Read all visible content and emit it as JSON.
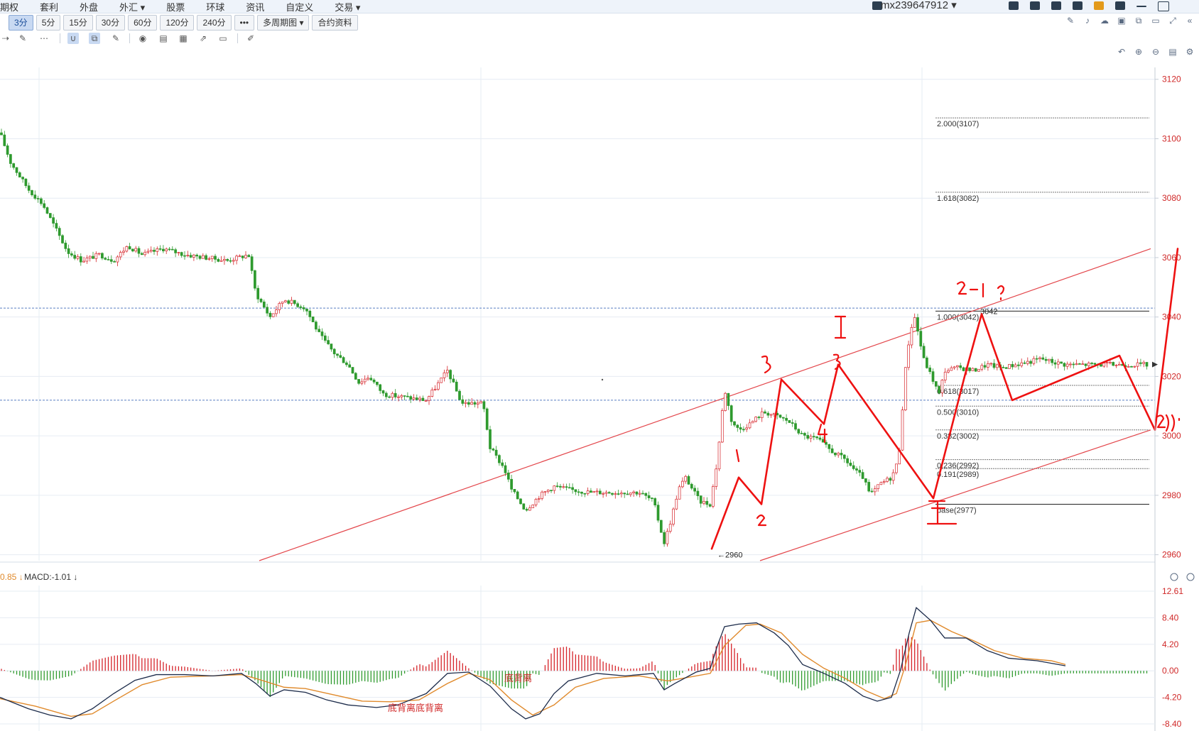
{
  "menu": {
    "items": [
      "期权",
      "套利",
      "外盘",
      "外汇 ▾",
      "股票",
      "环球",
      "资讯",
      "自定义",
      "交易 ▾"
    ],
    "username": "mx239647912",
    "username_suffix": "▾"
  },
  "timeframes": {
    "items": [
      "3分",
      "5分",
      "15分",
      "30分",
      "60分",
      "120分",
      "240分",
      "•••",
      "多周期图 ▾",
      "合约资料"
    ],
    "active_index": 0
  },
  "toolbar": {
    "tools": [
      "cursor-icon",
      "pen-icon",
      "dots-icon",
      "magnet-icon",
      "layers-icon",
      "pencil-icon",
      "eye-icon",
      "trash-icon",
      "grid-icon",
      "share-icon",
      "comment-icon",
      "pin-icon"
    ]
  },
  "right_tools": {
    "top_row": [
      "draw-icon",
      "bell-icon",
      "cloud-icon",
      "camera-icon",
      "copy-icon",
      "window-icon",
      "fullscreen-icon",
      "collapse-icon"
    ],
    "second_row": [
      "undo-icon",
      "zoom-in-icon",
      "zoom-out-icon",
      "save-icon",
      "settings-icon"
    ]
  },
  "colors": {
    "up": "#d6242a",
    "down": "#2e9a2e",
    "annotation": "#ee1111",
    "channel": "#e3454a",
    "grid": "#e6ecf3",
    "dif_line": "#1c2b4a",
    "dea_line": "#e08a2c",
    "axis_text": "#d02828"
  },
  "chart_data": {
    "type": "candlestick",
    "y_range": [
      2958,
      3124
    ],
    "price_ticks": [
      3120,
      3100,
      3080,
      3060,
      3040,
      3020,
      3000,
      2980,
      2960
    ],
    "price_path": [
      [
        0,
        3102
      ],
      [
        15,
        3092
      ],
      [
        40,
        3083
      ],
      [
        60,
        3078
      ],
      [
        80,
        3069
      ],
      [
        95,
        3062
      ],
      [
        115,
        3059
      ],
      [
        140,
        3061
      ],
      [
        160,
        3059
      ],
      [
        180,
        3064
      ],
      [
        200,
        3061
      ],
      [
        230,
        3063
      ],
      [
        260,
        3061
      ],
      [
        290,
        3060
      ],
      [
        320,
        3059
      ],
      [
        350,
        3061
      ],
      [
        360,
        3048
      ],
      [
        380,
        3040
      ],
      [
        400,
        3046
      ],
      [
        430,
        3043
      ],
      [
        450,
        3034
      ],
      [
        470,
        3028
      ],
      [
        490,
        3024
      ],
      [
        505,
        3018
      ],
      [
        520,
        3020
      ],
      [
        540,
        3014
      ],
      [
        570,
        3013
      ],
      [
        600,
        3012
      ],
      [
        630,
        3022
      ],
      [
        650,
        3011
      ],
      [
        680,
        3011
      ],
      [
        690,
        2996
      ],
      [
        710,
        2989
      ],
      [
        720,
        2982
      ],
      [
        740,
        2975
      ],
      [
        760,
        2980
      ],
      [
        780,
        2983
      ],
      [
        800,
        2982
      ],
      [
        830,
        2981
      ],
      [
        860,
        2981
      ],
      [
        900,
        2981
      ],
      [
        920,
        2978
      ],
      [
        935,
        2964
      ],
      [
        945,
        2972
      ],
      [
        955,
        2982
      ],
      [
        965,
        2986
      ],
      [
        985,
        2978
      ],
      [
        1000,
        2977
      ],
      [
        1010,
        2992
      ],
      [
        1020,
        3016
      ],
      [
        1030,
        3005
      ],
      [
        1040,
        3002
      ],
      [
        1055,
        3004
      ],
      [
        1075,
        3008
      ],
      [
        1090,
        3007
      ],
      [
        1110,
        3005
      ],
      [
        1130,
        3000
      ],
      [
        1150,
        2999
      ],
      [
        1170,
        2995
      ],
      [
        1190,
        2992
      ],
      [
        1205,
        2988
      ],
      [
        1215,
        2986
      ],
      [
        1225,
        2980
      ],
      [
        1240,
        2984
      ],
      [
        1255,
        2986
      ],
      [
        1265,
        2992
      ],
      [
        1270,
        3008
      ],
      [
        1276,
        3026
      ],
      [
        1282,
        3036
      ],
      [
        1288,
        3040
      ],
      [
        1300,
        3026
      ],
      [
        1315,
        3018
      ],
      [
        1322,
        3014
      ],
      [
        1330,
        3022
      ],
      [
        1350,
        3023
      ],
      [
        1370,
        3022
      ],
      [
        1390,
        3024
      ],
      [
        1410,
        3023
      ],
      [
        1430,
        3024
      ],
      [
        1450,
        3025
      ],
      [
        1465,
        3026
      ],
      [
        1480,
        3025
      ],
      [
        1500,
        3024
      ]
    ],
    "price_markers": {
      "low_label": "2960",
      "high_label": "3042"
    },
    "fibonacci": [
      {
        "label": "2.000(3107)",
        "price": 3107
      },
      {
        "label": "1.618(3082)",
        "price": 3082
      },
      {
        "label": "1.000(3042)",
        "price": 3042
      },
      {
        "label": "0.618(3017)",
        "price": 3017
      },
      {
        "label": "0.500(3010)",
        "price": 3010
      },
      {
        "label": "0.382(3002)",
        "price": 3002
      },
      {
        "label": "0.236(2992)",
        "price": 2992
      },
      {
        "label": "0.191(2989)",
        "price": 2989
      },
      {
        "label": "base(2977)",
        "price": 2977
      }
    ],
    "macd": {
      "title_prefix": "0.85",
      "title_label": "MACD:-1.01",
      "y_ticks": [
        "12.61",
        "8.40",
        "4.20",
        "0.00",
        "-4.20",
        "-8.40"
      ],
      "y_range": [
        -8.4,
        12.61
      ],
      "annotations": [
        "底背离",
        "底背离底背离"
      ],
      "dif": [
        [
          0,
          -4.2
        ],
        [
          40,
          -6.0
        ],
        [
          70,
          -7.0
        ],
        [
          100,
          -7.6
        ],
        [
          130,
          -6.0
        ],
        [
          160,
          -3.6
        ],
        [
          190,
          -1.5
        ],
        [
          220,
          -0.6
        ],
        [
          260,
          -0.6
        ],
        [
          300,
          -0.8
        ],
        [
          340,
          -0.4
        ],
        [
          360,
          -2.0
        ],
        [
          380,
          -4.0
        ],
        [
          400,
          -3.0
        ],
        [
          430,
          -3.4
        ],
        [
          460,
          -4.6
        ],
        [
          490,
          -5.4
        ],
        [
          530,
          -5.8
        ],
        [
          560,
          -5.4
        ],
        [
          600,
          -3.6
        ],
        [
          630,
          -0.4
        ],
        [
          660,
          -0.2
        ],
        [
          690,
          -2.4
        ],
        [
          720,
          -6.0
        ],
        [
          740,
          -7.6
        ],
        [
          760,
          -6.8
        ],
        [
          780,
          -3.6
        ],
        [
          800,
          -1.6
        ],
        [
          840,
          -0.4
        ],
        [
          880,
          -0.8
        ],
        [
          920,
          -0.4
        ],
        [
          935,
          -3.0
        ],
        [
          950,
          -2.0
        ],
        [
          980,
          -0.2
        ],
        [
          1000,
          0.4
        ],
        [
          1010,
          4.0
        ],
        [
          1020,
          7.0
        ],
        [
          1040,
          7.4
        ],
        [
          1065,
          7.6
        ],
        [
          1090,
          6.0
        ],
        [
          1110,
          4.0
        ],
        [
          1130,
          1.0
        ],
        [
          1160,
          -0.4
        ],
        [
          1190,
          -2.0
        ],
        [
          1215,
          -4.0
        ],
        [
          1235,
          -4.8
        ],
        [
          1255,
          -4.2
        ],
        [
          1268,
          0.2
        ],
        [
          1280,
          6.0
        ],
        [
          1290,
          10.0
        ],
        [
          1310,
          8.0
        ],
        [
          1330,
          5.2
        ],
        [
          1360,
          5.2
        ],
        [
          1390,
          3.2
        ],
        [
          1420,
          2.0
        ],
        [
          1460,
          1.6
        ],
        [
          1500,
          0.8
        ]
      ],
      "dea": [
        [
          0,
          -4.4
        ],
        [
          50,
          -5.6
        ],
        [
          100,
          -7.2
        ],
        [
          130,
          -6.8
        ],
        [
          160,
          -4.8
        ],
        [
          200,
          -2.2
        ],
        [
          240,
          -1.0
        ],
        [
          300,
          -0.8
        ],
        [
          340,
          -0.6
        ],
        [
          360,
          -1.2
        ],
        [
          400,
          -2.6
        ],
        [
          430,
          -2.8
        ],
        [
          470,
          -3.8
        ],
        [
          510,
          -4.8
        ],
        [
          550,
          -4.9
        ],
        [
          590,
          -4.6
        ],
        [
          630,
          -2.0
        ],
        [
          660,
          -0.4
        ],
        [
          690,
          -1.4
        ],
        [
          720,
          -4.6
        ],
        [
          750,
          -7.0
        ],
        [
          780,
          -5.4
        ],
        [
          810,
          -2.6
        ],
        [
          850,
          -1.2
        ],
        [
          900,
          -0.8
        ],
        [
          940,
          -1.6
        ],
        [
          970,
          -1.0
        ],
        [
          1000,
          -0.4
        ],
        [
          1020,
          4.0
        ],
        [
          1050,
          7.2
        ],
        [
          1070,
          7.4
        ],
        [
          1100,
          6.0
        ],
        [
          1130,
          2.6
        ],
        [
          1160,
          0.4
        ],
        [
          1190,
          -1.2
        ],
        [
          1220,
          -3.2
        ],
        [
          1245,
          -4.4
        ],
        [
          1262,
          -3.6
        ],
        [
          1275,
          1.0
        ],
        [
          1290,
          7.6
        ],
        [
          1310,
          8.0
        ],
        [
          1340,
          6.2
        ],
        [
          1370,
          4.8
        ],
        [
          1400,
          3.2
        ],
        [
          1440,
          2.0
        ],
        [
          1480,
          1.6
        ],
        [
          1500,
          1.0
        ]
      ]
    }
  }
}
